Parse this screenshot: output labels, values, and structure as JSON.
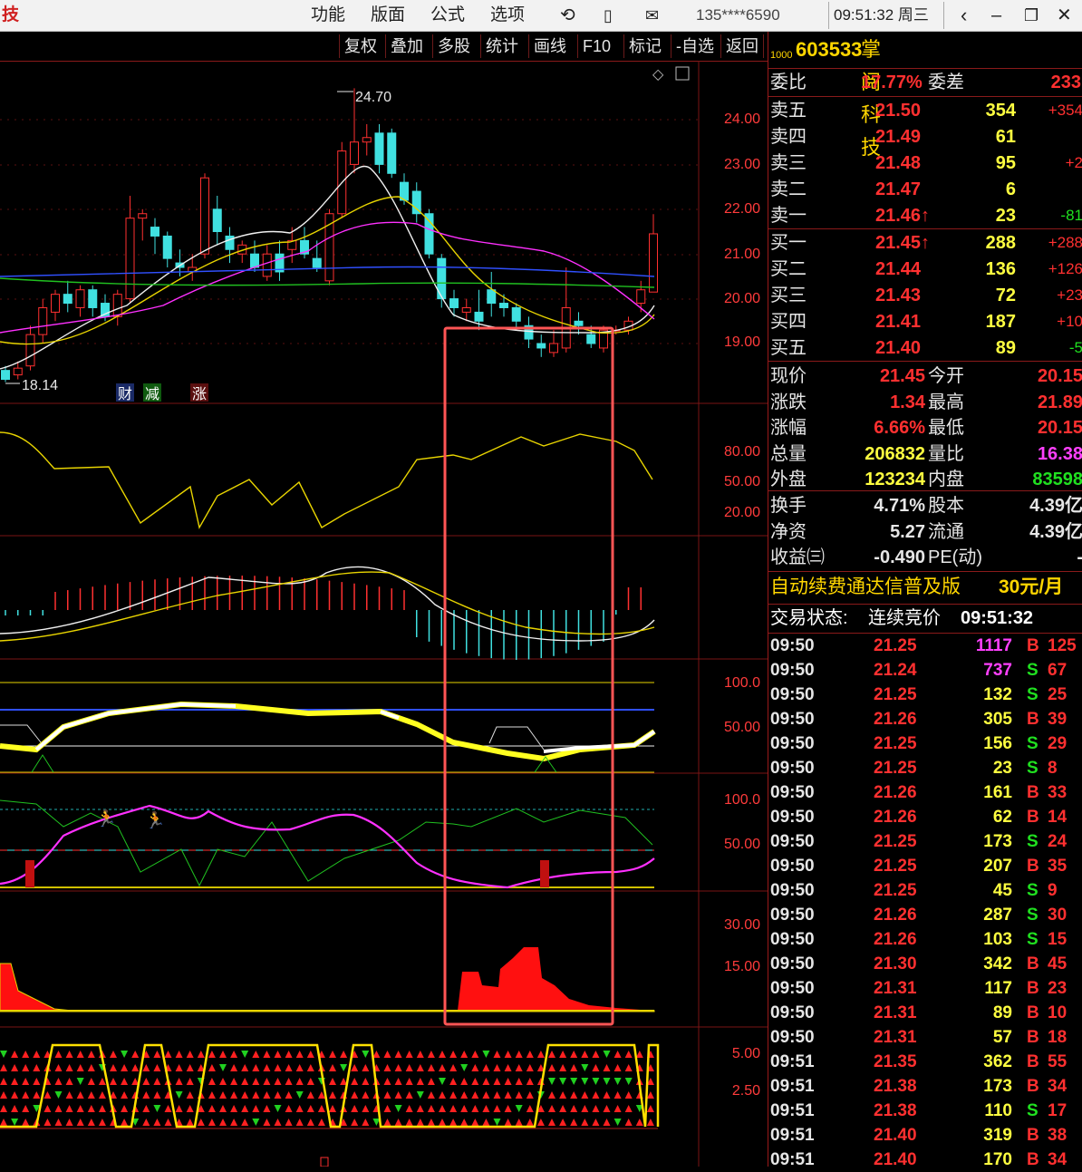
{
  "window": {
    "title_fragment": "技",
    "menus": [
      "功能",
      "版面",
      "公式",
      "选项"
    ],
    "phone": "135****6590",
    "clock": "09:51:32 周三"
  },
  "toolbar": {
    "buttons": [
      "复权",
      "叠加",
      "多股",
      "统计",
      "画线",
      "F10",
      "标记",
      "-自选",
      "返回"
    ]
  },
  "chart_labels": {
    "high_marker": "24.70",
    "low_marker": "18.14",
    "tags": [
      "财",
      "减",
      "涨"
    ],
    "price_axis": [
      "24.00",
      "23.00",
      "22.00",
      "21.00",
      "20.00",
      "19.00"
    ],
    "ind1_axis": [
      "80.00",
      "50.00",
      "20.00"
    ],
    "ind3_axis": [
      "100.0",
      "50.00"
    ],
    "ind4_axis": [
      "100.0",
      "50.00"
    ],
    "ind5_axis": [
      "30.00",
      "15.00"
    ],
    "ind6_axis": [
      "5.00",
      "2.50"
    ]
  },
  "stock": {
    "prefix": "1000",
    "code": "603533",
    "name": "掌阅科技"
  },
  "orderbook": {
    "weibi_label": "委比",
    "weibi_value": "17.77%",
    "weicha_label": "委差",
    "weicha_value": "233",
    "asks": [
      {
        "label": "卖五",
        "price": "21.50",
        "vol": "354",
        "chg": "+354"
      },
      {
        "label": "卖四",
        "price": "21.49",
        "vol": "61",
        "chg": ""
      },
      {
        "label": "卖三",
        "price": "21.48",
        "vol": "95",
        "chg": "+2"
      },
      {
        "label": "卖二",
        "price": "21.47",
        "vol": "6",
        "chg": ""
      },
      {
        "label": "卖一",
        "price": "21.46↑",
        "vol": "23",
        "chg": "-81"
      }
    ],
    "bids": [
      {
        "label": "买一",
        "price": "21.45↑",
        "vol": "288",
        "chg": "+288"
      },
      {
        "label": "买二",
        "price": "21.44",
        "vol": "136",
        "chg": "+126"
      },
      {
        "label": "买三",
        "price": "21.43",
        "vol": "72",
        "chg": "+23"
      },
      {
        "label": "买四",
        "price": "21.41",
        "vol": "187",
        "chg": "+10"
      },
      {
        "label": "买五",
        "price": "21.40",
        "vol": "89",
        "chg": "-5"
      }
    ]
  },
  "quote": [
    {
      "l1": "现价",
      "v1": "21.45",
      "l2": "今开",
      "v2": "20.15"
    },
    {
      "l1": "涨跌",
      "v1": "1.34",
      "l2": "最高",
      "v2": "21.89"
    },
    {
      "l1": "涨幅",
      "v1": "6.66%",
      "l2": "最低",
      "v2": "20.15"
    },
    {
      "l1": "总量",
      "v1": "206832",
      "l2": "量比",
      "v2": "16.38"
    },
    {
      "l1": "外盘",
      "v1": "123234",
      "l2": "内盘",
      "v2": "83598"
    }
  ],
  "fundamentals": [
    {
      "l1": "换手",
      "v1": "4.71%",
      "l2": "股本",
      "v2": "4.39亿"
    },
    {
      "l1": "净资",
      "v1": "5.27",
      "l2": "流通",
      "v2": "4.39亿"
    },
    {
      "l1": "收益㈢",
      "v1": "-0.490",
      "l2": "PE(动)",
      "v2": "-"
    }
  ],
  "promo": {
    "text": "自动续费通达信普及版",
    "price": "30元/月"
  },
  "trade_status": {
    "label": "交易状态:",
    "value": "连续竞价",
    "time": "09:51:32"
  },
  "ticks": [
    {
      "t": "09:50",
      "p": "21.25",
      "v": "1117",
      "bs": "B",
      "n": "125"
    },
    {
      "t": "09:50",
      "p": "21.24",
      "v": "737",
      "bs": "S",
      "n": "67"
    },
    {
      "t": "09:50",
      "p": "21.25",
      "v": "132",
      "bs": "S",
      "n": "25"
    },
    {
      "t": "09:50",
      "p": "21.26",
      "v": "305",
      "bs": "B",
      "n": "39"
    },
    {
      "t": "09:50",
      "p": "21.25",
      "v": "156",
      "bs": "S",
      "n": "29"
    },
    {
      "t": "09:50",
      "p": "21.25",
      "v": "23",
      "bs": "S",
      "n": "8"
    },
    {
      "t": "09:50",
      "p": "21.26",
      "v": "161",
      "bs": "B",
      "n": "33"
    },
    {
      "t": "09:50",
      "p": "21.26",
      "v": "62",
      "bs": "B",
      "n": "14"
    },
    {
      "t": "09:50",
      "p": "21.25",
      "v": "173",
      "bs": "S",
      "n": "24"
    },
    {
      "t": "09:50",
      "p": "21.25",
      "v": "207",
      "bs": "B",
      "n": "35"
    },
    {
      "t": "09:50",
      "p": "21.25",
      "v": "45",
      "bs": "S",
      "n": "9"
    },
    {
      "t": "09:50",
      "p": "21.26",
      "v": "287",
      "bs": "S",
      "n": "30"
    },
    {
      "t": "09:50",
      "p": "21.26",
      "v": "103",
      "bs": "S",
      "n": "15"
    },
    {
      "t": "09:50",
      "p": "21.30",
      "v": "342",
      "bs": "B",
      "n": "45"
    },
    {
      "t": "09:50",
      "p": "21.31",
      "v": "117",
      "bs": "B",
      "n": "23"
    },
    {
      "t": "09:50",
      "p": "21.31",
      "v": "89",
      "bs": "B",
      "n": "10"
    },
    {
      "t": "09:50",
      "p": "21.31",
      "v": "57",
      "bs": "B",
      "n": "18"
    },
    {
      "t": "09:51",
      "p": "21.35",
      "v": "362",
      "bs": "B",
      "n": "55"
    },
    {
      "t": "09:51",
      "p": "21.38",
      "v": "173",
      "bs": "B",
      "n": "34"
    },
    {
      "t": "09:51",
      "p": "21.38",
      "v": "110",
      "bs": "S",
      "n": "17"
    },
    {
      "t": "09:51",
      "p": "21.40",
      "v": "319",
      "bs": "B",
      "n": "38"
    },
    {
      "t": "09:51",
      "p": "21.40",
      "v": "170",
      "bs": "B",
      "n": "34"
    }
  ],
  "candles": [
    {
      "o": 18.4,
      "c": 18.2,
      "h": 18.5,
      "l": 18.14
    },
    {
      "o": 18.3,
      "c": 18.45,
      "h": 18.6,
      "l": 18.2
    },
    {
      "o": 18.5,
      "c": 19.2,
      "h": 19.4,
      "l": 18.4
    },
    {
      "o": 19.2,
      "c": 19.8,
      "h": 20.0,
      "l": 19.0
    },
    {
      "o": 19.7,
      "c": 20.1,
      "h": 20.2,
      "l": 19.5
    },
    {
      "o": 20.1,
      "c": 19.9,
      "h": 20.4,
      "l": 19.7
    },
    {
      "o": 19.8,
      "c": 20.2,
      "h": 20.3,
      "l": 19.6
    },
    {
      "o": 20.2,
      "c": 19.8,
      "h": 20.3,
      "l": 19.6
    },
    {
      "o": 19.9,
      "c": 19.6,
      "h": 20.1,
      "l": 19.5
    },
    {
      "o": 19.6,
      "c": 20.1,
      "h": 20.2,
      "l": 19.4
    },
    {
      "o": 20.0,
      "c": 21.8,
      "h": 22.3,
      "l": 19.9
    },
    {
      "o": 21.8,
      "c": 21.9,
      "h": 22.0,
      "l": 21.3
    },
    {
      "o": 21.6,
      "c": 21.4,
      "h": 21.8,
      "l": 21.0
    },
    {
      "o": 21.4,
      "c": 20.9,
      "h": 21.5,
      "l": 20.7
    },
    {
      "o": 20.8,
      "c": 20.7,
      "h": 21.1,
      "l": 20.5
    },
    {
      "o": 20.6,
      "c": 20.7,
      "h": 21.0,
      "l": 20.4
    },
    {
      "o": 21.0,
      "c": 22.7,
      "h": 22.8,
      "l": 20.9
    },
    {
      "o": 22.0,
      "c": 21.5,
      "h": 22.3,
      "l": 21.2
    },
    {
      "o": 21.4,
      "c": 21.1,
      "h": 21.6,
      "l": 20.8
    },
    {
      "o": 21.0,
      "c": 21.2,
      "h": 21.3,
      "l": 20.8
    },
    {
      "o": 21.0,
      "c": 20.7,
      "h": 21.3,
      "l": 20.6
    },
    {
      "o": 20.5,
      "c": 21.0,
      "h": 21.2,
      "l": 20.4
    },
    {
      "o": 21.0,
      "c": 20.6,
      "h": 21.3,
      "l": 20.4
    },
    {
      "o": 21.1,
      "c": 21.3,
      "h": 21.6,
      "l": 20.8
    },
    {
      "o": 21.3,
      "c": 21.0,
      "h": 21.6,
      "l": 20.9
    },
    {
      "o": 20.9,
      "c": 20.7,
      "h": 21.3,
      "l": 20.6
    },
    {
      "o": 20.4,
      "c": 21.9,
      "h": 22.0,
      "l": 20.3
    },
    {
      "o": 21.9,
      "c": 23.3,
      "h": 23.5,
      "l": 21.8
    },
    {
      "o": 23.0,
      "c": 23.5,
      "h": 24.7,
      "l": 22.8
    },
    {
      "o": 23.5,
      "c": 23.6,
      "h": 23.9,
      "l": 23.2
    },
    {
      "o": 23.7,
      "c": 23.0,
      "h": 23.9,
      "l": 22.8
    },
    {
      "o": 23.7,
      "c": 22.8,
      "h": 23.8,
      "l": 22.7
    },
    {
      "o": 22.6,
      "c": 22.2,
      "h": 22.8,
      "l": 22.1
    },
    {
      "o": 22.4,
      "c": 21.9,
      "h": 22.6,
      "l": 21.7
    },
    {
      "o": 21.9,
      "c": 21.0,
      "h": 22.0,
      "l": 20.9
    },
    {
      "o": 20.9,
      "c": 20.0,
      "h": 21.0,
      "l": 19.8
    },
    {
      "o": 20.0,
      "c": 19.8,
      "h": 20.2,
      "l": 19.6
    },
    {
      "o": 19.7,
      "c": 19.8,
      "h": 20.0,
      "l": 19.5
    },
    {
      "o": 19.7,
      "c": 19.5,
      "h": 20.2,
      "l": 19.3
    },
    {
      "o": 20.2,
      "c": 19.9,
      "h": 20.6,
      "l": 19.6
    },
    {
      "o": 19.9,
      "c": 19.8,
      "h": 20.1,
      "l": 19.6
    },
    {
      "o": 19.8,
      "c": 19.5,
      "h": 19.9,
      "l": 19.3
    },
    {
      "o": 19.4,
      "c": 19.1,
      "h": 19.6,
      "l": 18.9
    },
    {
      "o": 19.0,
      "c": 18.9,
      "h": 19.2,
      "l": 18.7
    },
    {
      "o": 18.8,
      "c": 19.0,
      "h": 19.3,
      "l": 18.7
    },
    {
      "o": 18.9,
      "c": 19.8,
      "h": 20.7,
      "l": 18.8
    },
    {
      "o": 19.5,
      "c": 19.4,
      "h": 19.7,
      "l": 19.2
    },
    {
      "o": 19.2,
      "c": 19.0,
      "h": 19.4,
      "l": 18.9
    },
    {
      "o": 18.9,
      "c": 19.3,
      "h": 19.4,
      "l": 18.8
    },
    {
      "o": 19.3,
      "c": 19.3,
      "h": 19.4,
      "l": 19.2
    },
    {
      "o": 19.3,
      "c": 19.5,
      "h": 19.6,
      "l": 19.2
    },
    {
      "o": 19.9,
      "c": 20.2,
      "h": 20.4,
      "l": 19.7
    },
    {
      "o": 20.15,
      "c": 21.45,
      "h": 21.89,
      "l": 20.15
    }
  ]
}
